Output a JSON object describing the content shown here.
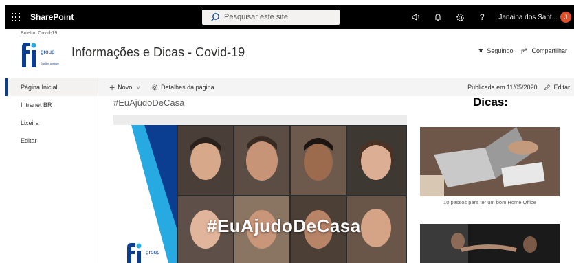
{
  "suite_bar": {
    "app_name": "SharePoint",
    "search_placeholder": "Pesquisar este site",
    "user_name": "Janaina dos Sant...",
    "user_initial": "J",
    "icons": [
      "waffle-icon",
      "search-icon",
      "megaphone-icon",
      "bell-icon",
      "gear-icon",
      "help-icon"
    ]
  },
  "site_header": {
    "breadcrumb": "Boletim Covid-19",
    "title": "Informações e Dicas - Covid-19",
    "logo_word": "group",
    "logo_tagline": "Excellent company",
    "follow_label": "Seguindo",
    "share_label": "Compartilhar"
  },
  "left_nav": {
    "items": [
      {
        "label": "Página Inicial",
        "selected": true
      },
      {
        "label": "Intranet BR",
        "selected": false
      },
      {
        "label": "Lixeira",
        "selected": false
      },
      {
        "label": "Editar",
        "selected": false
      }
    ]
  },
  "command_bar": {
    "new_label": "Novo",
    "details_label": "Detalhes da página",
    "published_label": "Publicada em 11/05/2020",
    "edit_label": "Editar"
  },
  "main": {
    "section_title": "#EuAjudoDeCasa",
    "hero_text": "#EuAjudoDeCasa",
    "hero_logo_word": "group",
    "tips_title": "Dicas:",
    "tip1_caption": "10 passos para ter um bom Home Office"
  },
  "colors": {
    "suite_bar": "#000000",
    "brand_blue": "#0b3d91",
    "hero_cyan": "#27a9e1",
    "avatar": "#e0502a"
  }
}
